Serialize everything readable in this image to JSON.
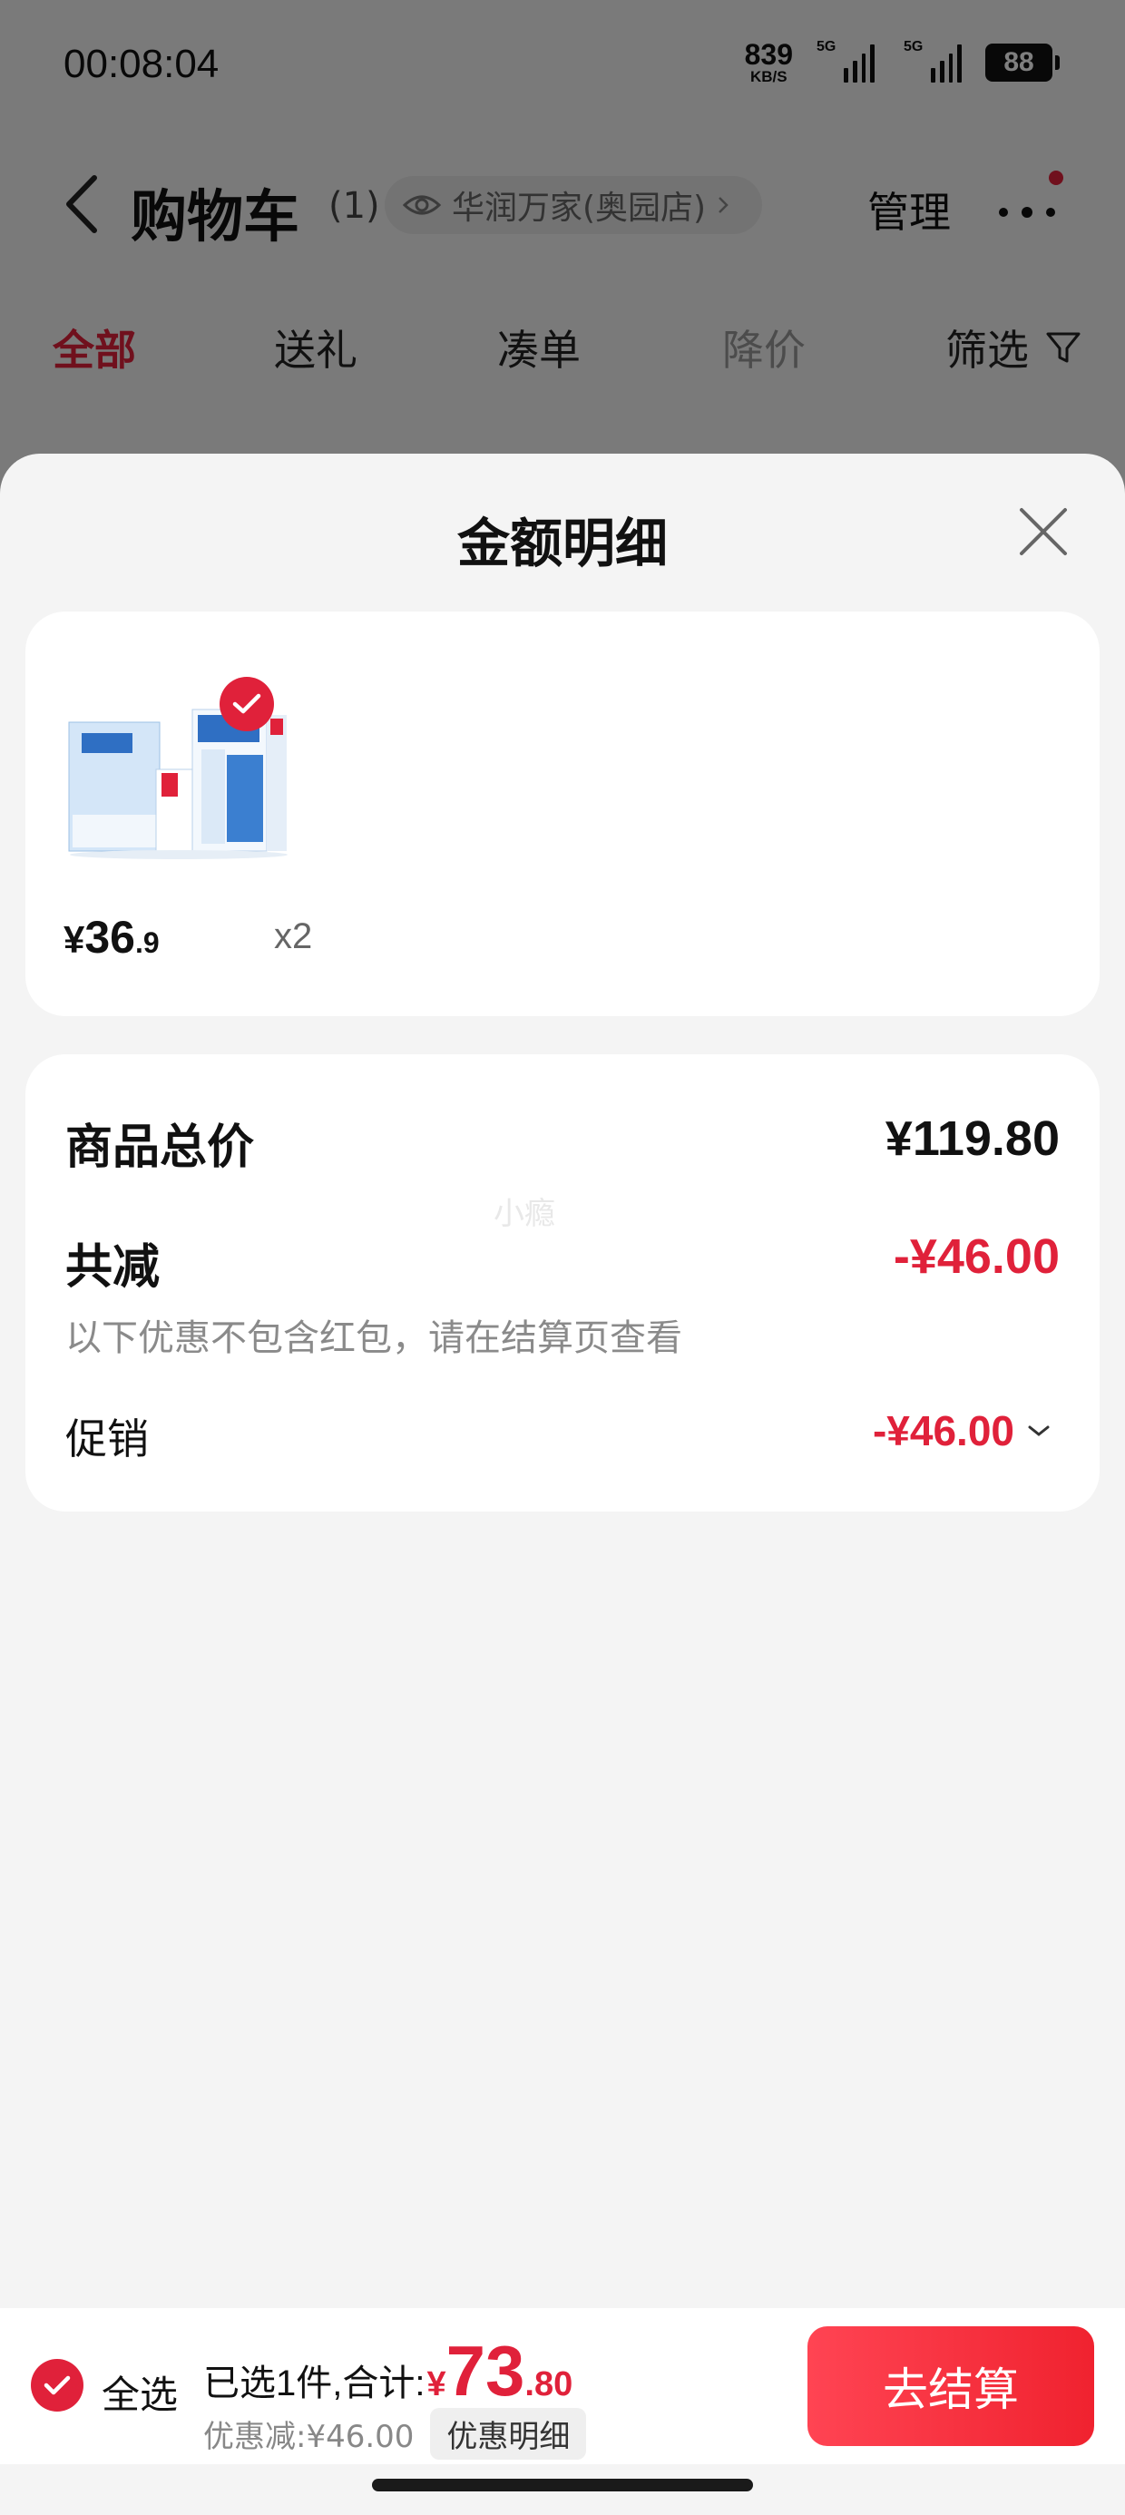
{
  "status_bar": {
    "time": "00:08:04",
    "net_speed_value": "839",
    "net_speed_unit": "KB/S",
    "sig1_label": "5G",
    "sig2_label": "5G",
    "battery": "88"
  },
  "nav": {
    "title": "购物车",
    "count": "(1)",
    "store": "华润万家(奥园店)",
    "manage": "管理"
  },
  "filter_tabs": [
    {
      "label": "全部"
    },
    {
      "label": "送礼"
    },
    {
      "label": "凑单"
    },
    {
      "label": "降价"
    },
    {
      "label": "筛选"
    }
  ],
  "sheet": {
    "title": "金额明细",
    "item": {
      "price_currency": "¥",
      "price_int": "36",
      "price_dec": ".9",
      "quantity": "x2"
    },
    "summary": {
      "total_label": "商品总价",
      "total_value": "¥119.80",
      "watermark": "小瘾",
      "reduce_label": "共减",
      "reduce_value": "-¥46.00",
      "note": "以下优惠不包含红包，请在结算页查看",
      "promo_label": "促销",
      "promo_value": "-¥46.00"
    }
  },
  "bottom_bar": {
    "select_all": "全选",
    "selected_text": "已选1件,合计:",
    "total_currency": "¥",
    "total_int": "73",
    "total_dec": ".80",
    "discount_text": "优惠减:¥46.00",
    "detail_button": "优惠明细",
    "checkout": "去结算"
  },
  "colors": {
    "accent": "#e0213a",
    "overlay": "rgba(0,0,0,0.5)"
  }
}
